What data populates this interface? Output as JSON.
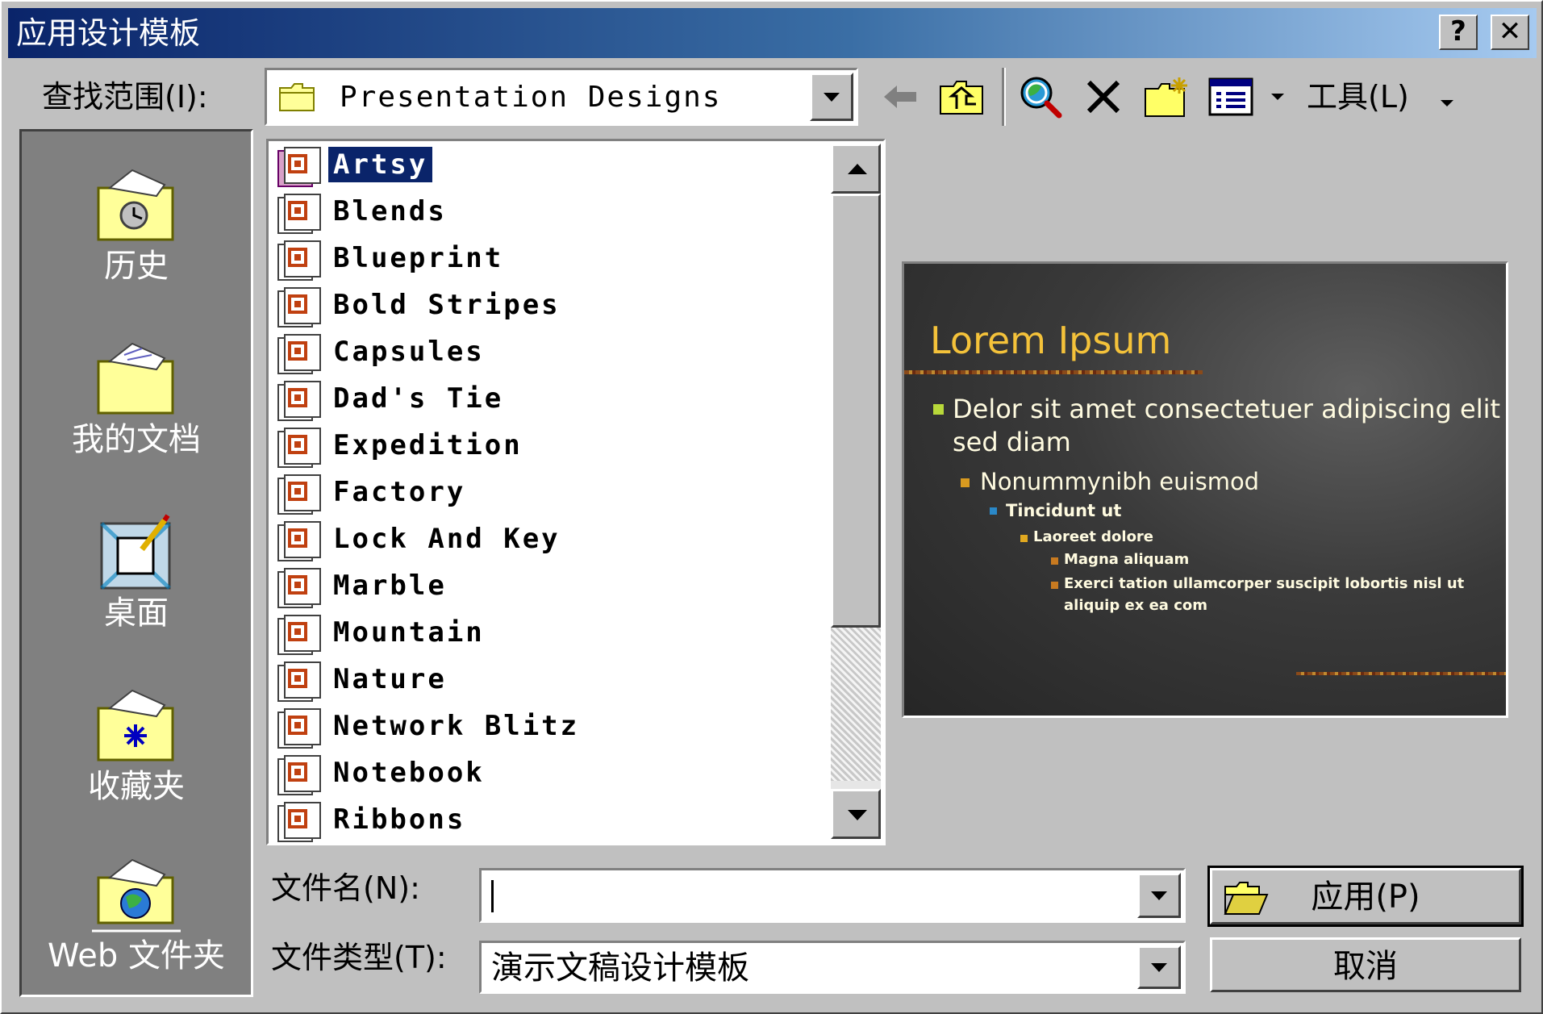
{
  "window": {
    "title": "应用设计模板",
    "help_btn": "?",
    "close_btn": "✕"
  },
  "toolbar": {
    "lookin_label": "查找范围(I):",
    "lookin_value": "Presentation Designs",
    "icons": [
      "back-arrow-icon",
      "up-folder-icon",
      "search-web-icon",
      "delete-icon",
      "new-folder-icon",
      "views-icon"
    ],
    "tools_label": "工具(L)"
  },
  "places": [
    {
      "label": "历史",
      "icon": "history-folder-icon"
    },
    {
      "label": "我的文档",
      "icon": "my-documents-folder-icon"
    },
    {
      "label": "桌面",
      "icon": "desktop-icon"
    },
    {
      "label": "收藏夹",
      "icon": "favorites-folder-icon"
    },
    {
      "label": "Web 文件夹",
      "icon": "web-folders-icon"
    }
  ],
  "files": [
    {
      "name": "Artsy",
      "selected": true
    },
    {
      "name": "Blends"
    },
    {
      "name": "Blueprint"
    },
    {
      "name": "Bold Stripes"
    },
    {
      "name": "Capsules"
    },
    {
      "name": "Dad's Tie"
    },
    {
      "name": "Expedition"
    },
    {
      "name": "Factory"
    },
    {
      "name": "Lock And Key"
    },
    {
      "name": "Marble"
    },
    {
      "name": "Mountain"
    },
    {
      "name": "Nature"
    },
    {
      "name": "Network Blitz"
    },
    {
      "name": "Notebook"
    },
    {
      "name": "Ribbons"
    }
  ],
  "preview": {
    "title": "Lorem Ipsum",
    "line1": "Delor sit amet consectetuer adipiscing elit",
    "line1b": "sed diam",
    "line2": "Nonummynibh euismod",
    "line3": "Tincidunt ut",
    "line4": "Laoreet dolore",
    "line5": "Magna aliquam",
    "line6": "Exerci tation ullamcorper suscipit lobortis nisl ut",
    "line6b": "aliquip ex ea com",
    "colors": {
      "title": "#f4c23a",
      "bullet1": "#b8d83a",
      "bullet2": "#d89a20",
      "bullet3": "#2a88c8"
    }
  },
  "bottom": {
    "filename_label": "文件名(N):",
    "filename_value": "",
    "filetype_label": "文件类型(T):",
    "filetype_value": "演示文稿设计模板",
    "apply_label": "应用(P)",
    "cancel_label": "取消"
  },
  "colors": {
    "titlebar": "#0a246a",
    "selection": "#0a246a",
    "face": "#c0c0c0",
    "places_bar": "#808080"
  }
}
